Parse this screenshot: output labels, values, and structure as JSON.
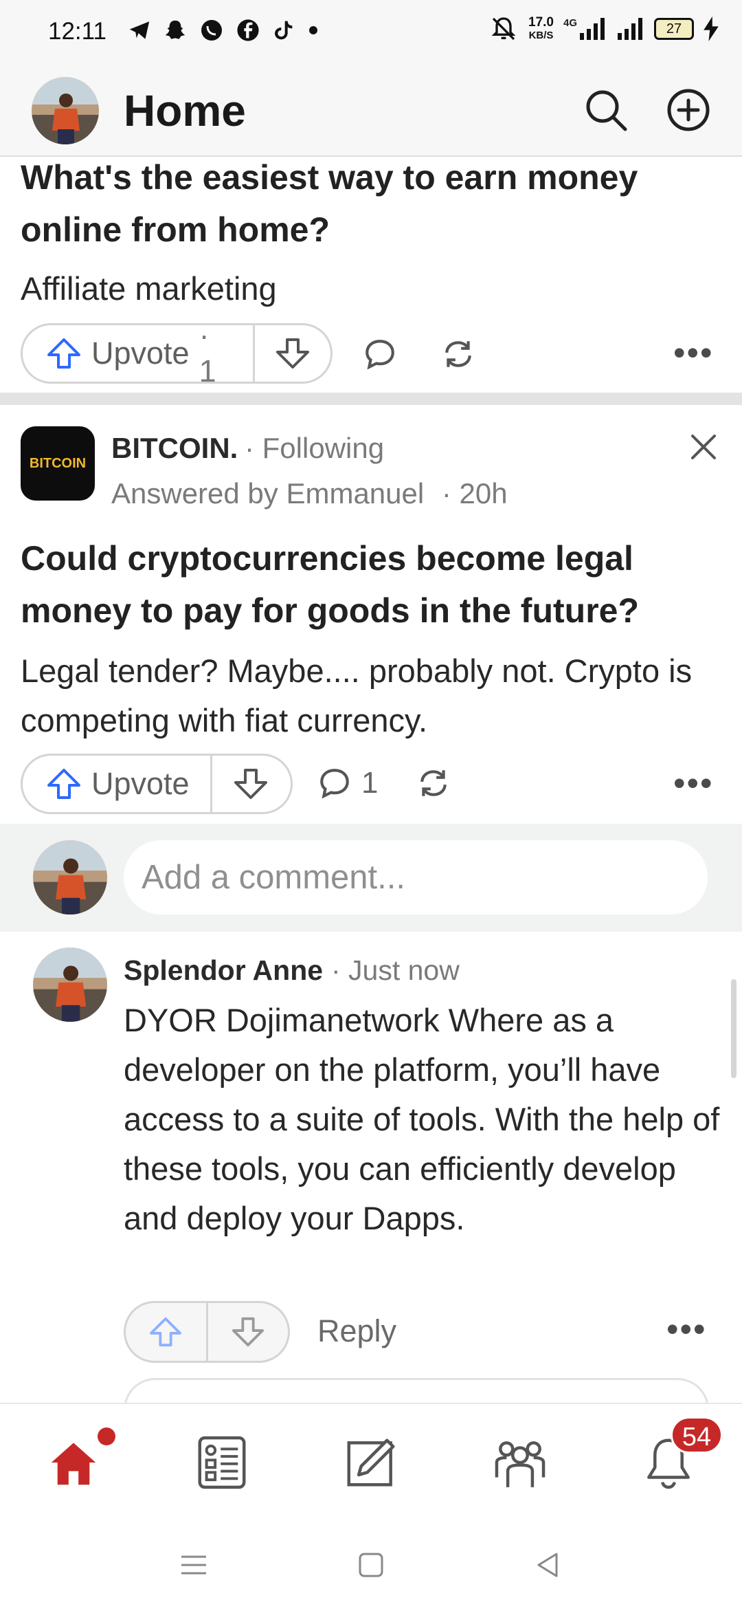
{
  "status_bar": {
    "time": "12:11",
    "net_speed_value": "17.0",
    "net_speed_unit": "KB/S",
    "network_label": "4G",
    "battery": "27",
    "app_icons": [
      "telegram-icon",
      "snapchat-icon",
      "whatsapp-icon",
      "facebook-icon",
      "tiktok-icon",
      "dot-icon"
    ]
  },
  "header": {
    "title": "Home"
  },
  "post1": {
    "question": "What's the easiest way to earn money online from home?",
    "answer": "Affiliate marketing",
    "upvote_label": "Upvote",
    "upvote_count": "· 1",
    "more": "•••"
  },
  "post2": {
    "source_logo": "BITCOIN",
    "source_name": "BITCOIN.",
    "following": "· Following",
    "answered_by": "Answered by Emmanuel",
    "time": "· 20h",
    "question": "Could cryptocurrencies become legal money to pay for goods in the future?",
    "answer": "Legal tender? Maybe.... probably not. Crypto is competing with fiat currency.",
    "upvote_label": "Upvote",
    "comment_count": "1",
    "more": "•••"
  },
  "comment_box": {
    "placeholder": "Add a comment..."
  },
  "comment": {
    "author": "Splendor Anne",
    "time": "· Just now",
    "body": "DYOR Dojimanetwork Where as a developer on the platform, you’ll have access to a suite of tools. With the help of these tools, you can efficiently develop and deploy your Dapps.",
    "reply_label": "Reply",
    "more": "•••"
  },
  "bottom_nav": {
    "items": [
      "home-icon",
      "following-icon",
      "answer-icon",
      "spaces-icon",
      "notifications-icon"
    ],
    "notification_count": "54"
  },
  "colors": {
    "accent": "#c62828",
    "upvote_blue": "#2e69ff",
    "text": "#282828",
    "muted": "#7a7a7a"
  }
}
